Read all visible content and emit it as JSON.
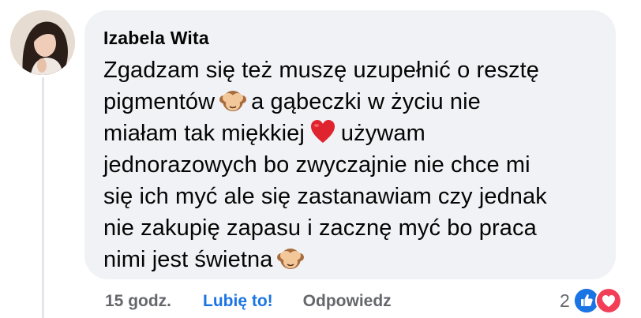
{
  "comment": {
    "author": "Izabela Wita",
    "lines": [
      {
        "a": "Zgadzam się też muszę uzupełnić o resztę",
        "emoji": "",
        "b": ""
      },
      {
        "a": "pigmentów",
        "emoji": "see-no-evil-monkey",
        "b": "a gąbeczki w życiu nie"
      },
      {
        "a": "miałam tak miękkiej",
        "emoji": "red-heart",
        "b": "używam"
      },
      {
        "a": "jednorazowych bo zwyczajnie nie chce mi",
        "emoji": "",
        "b": ""
      },
      {
        "a": "się ich myć ale się zastanawiam czy jednak",
        "emoji": "",
        "b": ""
      },
      {
        "a": "nie zakupię zapasu i zacznę myć bo praca",
        "emoji": "",
        "b": ""
      },
      {
        "a": "nimi jest świetna",
        "emoji": "see-no-evil-monkey",
        "b": ""
      }
    ]
  },
  "footer": {
    "time": "15 godz.",
    "like_label": "Lubię to!",
    "reply_label": "Odpowiedz"
  },
  "reactions": {
    "count": "2",
    "icons": [
      "like-reaction-icon",
      "love-reaction-icon"
    ],
    "colors": {
      "like": "#1b74e4",
      "love": "#f33e58"
    }
  }
}
